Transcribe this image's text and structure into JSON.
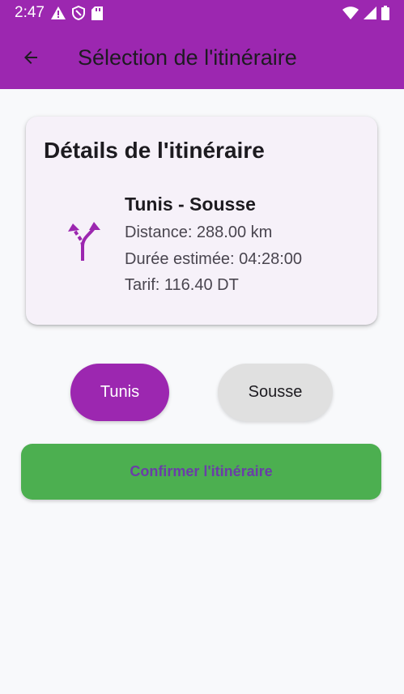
{
  "status_bar": {
    "time": "2:47",
    "icons": [
      "warning-icon",
      "shield-icon",
      "sd-card-icon",
      "wifi-icon",
      "signal-icon",
      "battery-icon"
    ]
  },
  "app_bar": {
    "title": "Sélection de l'itinéraire",
    "back_icon": "arrow-back-icon",
    "color": "#9c27b0"
  },
  "card": {
    "title": "Détails de l'itinéraire",
    "icon": "route-fork-icon",
    "route_name": "Tunis - Sousse",
    "distance": "Distance: 288.00 km",
    "duration": "Durée estimée: 04:28:00",
    "fare": "Tarif: 116.40 DT"
  },
  "city_buttons": {
    "from": "Tunis",
    "to": "Sousse"
  },
  "confirm_button": {
    "label": "Confirmer l'itinéraire",
    "color": "#4caf50"
  }
}
